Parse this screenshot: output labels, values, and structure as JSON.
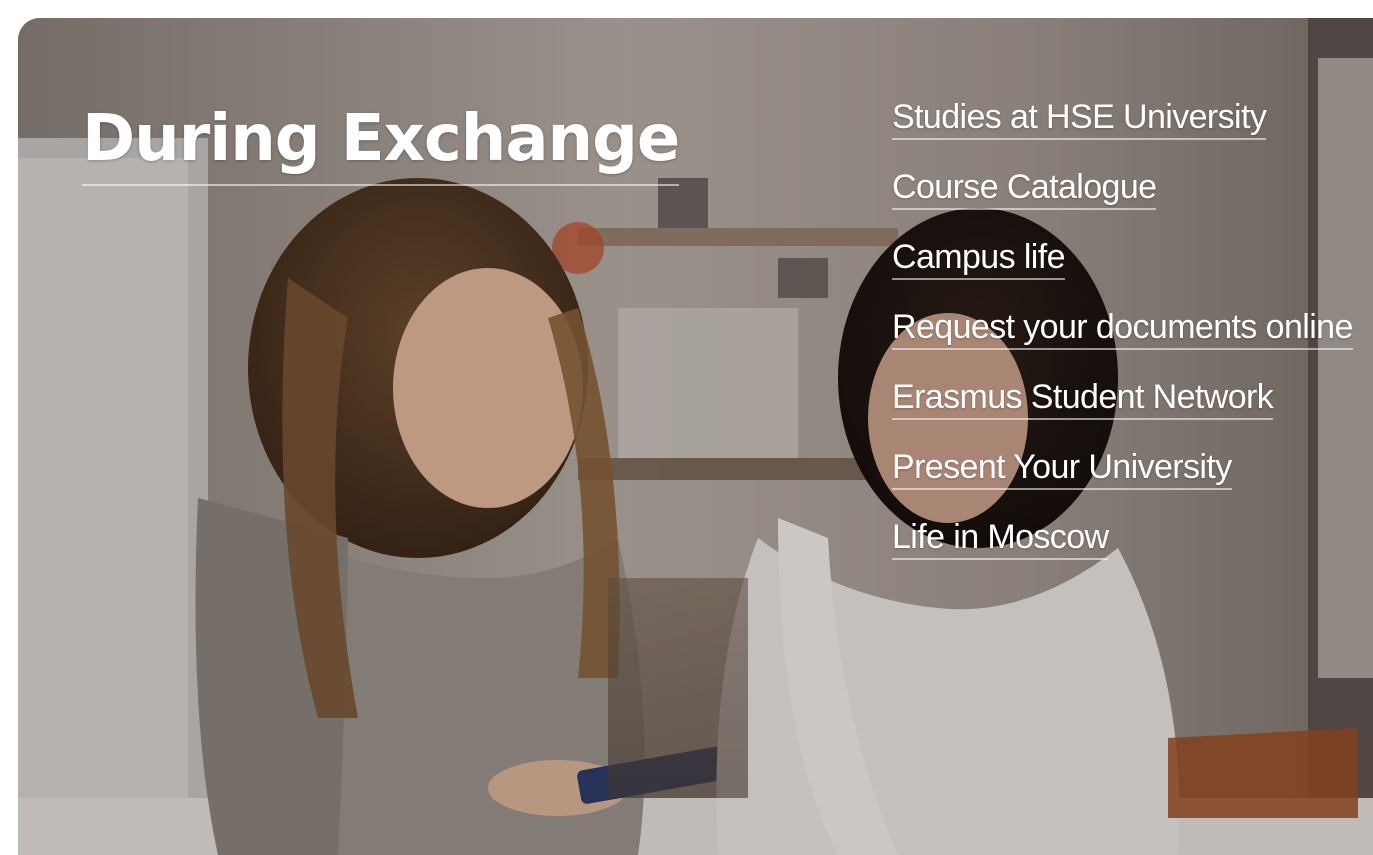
{
  "header": {
    "title": "During Exchange"
  },
  "menu": {
    "items": [
      {
        "label": "Studies at HSE University"
      },
      {
        "label": "Course Catalogue"
      },
      {
        "label": "Campus life"
      },
      {
        "label": "Request your documents online"
      },
      {
        "label": "Erasmus Student Network"
      },
      {
        "label": "Present Your University"
      },
      {
        "label": "Life in Moscow"
      }
    ]
  },
  "theme": {
    "text_color": "#ffffff",
    "background_white": "#ffffff"
  }
}
